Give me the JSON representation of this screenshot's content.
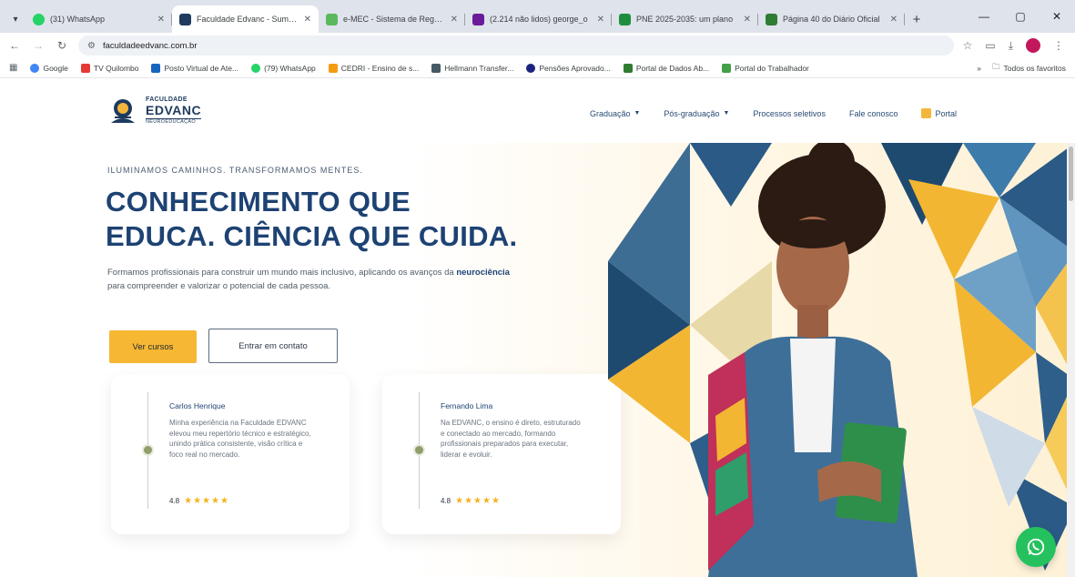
{
  "browser": {
    "tabs": [
      {
        "title": "(31) WhatsApp",
        "color": "#25d366",
        "active": false
      },
      {
        "title": "Faculdade Edvanc - Summer",
        "color": "#1e3a5f",
        "active": true
      },
      {
        "title": "e-MEC - Sistema de Regulaç",
        "color": "#5cb85c",
        "active": false
      },
      {
        "title": "(2.214 não lidos) george_o",
        "color": "#6a1b9a",
        "active": false
      },
      {
        "title": "PNE 2025-2035: um plano",
        "color": "#1e8e3e",
        "active": false
      },
      {
        "title": "Página 40 do Diário Oficial",
        "color": "#2e7d32",
        "active": false
      }
    ],
    "url": "faculdadeedvanc.com.br",
    "profile_initial": "",
    "bookmarks": [
      {
        "label": "Google",
        "color": "#4285f4"
      },
      {
        "label": "TV Quilombo",
        "color": "#e53935"
      },
      {
        "label": "Posto Virtual de Ate...",
        "color": "#1565c0"
      },
      {
        "label": "(79) WhatsApp",
        "color": "#25d366"
      },
      {
        "label": "CEDRI - Ensino de s...",
        "color": "#f39c12"
      },
      {
        "label": "Hellmann Transfer...",
        "color": "#455a64"
      },
      {
        "label": "Pensões Aprovado...",
        "color": "#1a237e"
      },
      {
        "label": "Portal de Dados Ab...",
        "color": "#2e7d32"
      },
      {
        "label": "Portal do Trabalhador",
        "color": "#43a047"
      }
    ],
    "bookmarks_more": "»",
    "all_bookmarks": "Todos os favoritos"
  },
  "site": {
    "logo": {
      "top": "FACULDADE",
      "main": "EDVANC",
      "sub": "NEUROEDUCAÇÃO"
    },
    "nav": [
      {
        "label": "Graduação",
        "caret": true
      },
      {
        "label": "Pós-graduação",
        "caret": true
      },
      {
        "label": "Processos seletivos",
        "caret": false
      },
      {
        "label": "Fale conosco",
        "caret": false
      }
    ],
    "portal_label": "Portal",
    "hero": {
      "eyebrow": "ILUMINAMOS CAMINHOS. TRANSFORMAMOS MENTES.",
      "headline_1": "CONHECIMENTO QUE",
      "headline_2": "EDUCA. CIÊNCIA QUE CUIDA.",
      "lede_before": "Formamos profissionais para construir um mundo mais inclusivo, aplicando os avanços da ",
      "lede_bold": "neurociência",
      "lede_after": " para compreender e valorizar o potencial de cada pessoa.",
      "primary_cta": "Ver cursos",
      "secondary_cta": "Entrar em contato"
    },
    "testimonials": [
      {
        "name": "Carlos Henrique",
        "quote": "Minha experiência na Faculdade EDVANC elevou meu repertório técnico e estratégico, unindo prática consistente, visão crítica e foco real no mercado.",
        "score": "4.8",
        "stars": "★★★★★"
      },
      {
        "name": "Fernando Lima",
        "quote": "Na EDVANC, o ensino é direto, estruturado e conectado ao mercado, formando profissionais preparados para executar, liderar e evoluir.",
        "score": "4.8",
        "stars": "★★★★★"
      }
    ]
  },
  "colors": {
    "brand_navy": "#1d4273",
    "accent_yellow": "#f6b733",
    "whatsapp_green": "#25c15e"
  }
}
